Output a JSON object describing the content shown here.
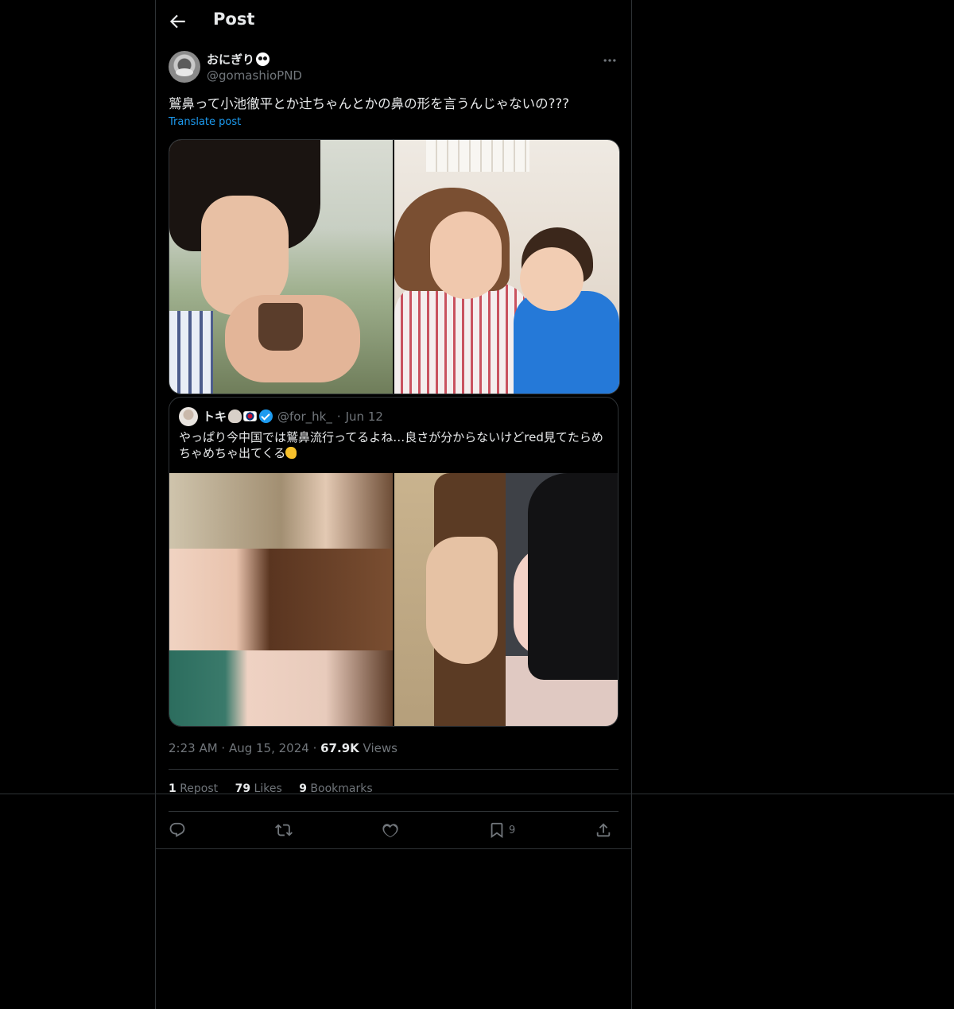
{
  "header": {
    "title": "Post"
  },
  "post": {
    "author_name": "おにぎり",
    "author_handle": "@gomashioPND",
    "text": "鷲鼻って小池徹平とか辻ちゃんとかの鼻の形を言うんじゃないの???",
    "translate_label": "Translate post",
    "timestamp": "2:23 AM · Aug 15, 2024 · ",
    "views_count": "67.9K",
    "views_label": "Views"
  },
  "quote": {
    "name": "トキ",
    "handle": "@for_hk_",
    "separator": "·",
    "date": "Jun 12",
    "text": "やっぱり今中国では鷲鼻流行ってるよね…良さが分からないけどred見てたらめちゃめちゃ出てくる"
  },
  "stats": {
    "reposts_count": "1",
    "reposts_label": "Repost",
    "likes_count": "79",
    "likes_label": "Likes",
    "bookmarks_count": "9",
    "bookmarks_label": "Bookmarks"
  },
  "actions": {
    "bookmark_count": "9"
  },
  "icons": [
    "back-arrow-icon",
    "more-icon",
    "reply-icon",
    "repost-icon",
    "like-icon",
    "bookmark-icon",
    "share-icon",
    "verified-icon"
  ],
  "colors": {
    "background": "#000000",
    "text": "#e7e9ea",
    "secondary": "#71767b",
    "accent": "#1d9bf0",
    "border": "#2f3336"
  }
}
